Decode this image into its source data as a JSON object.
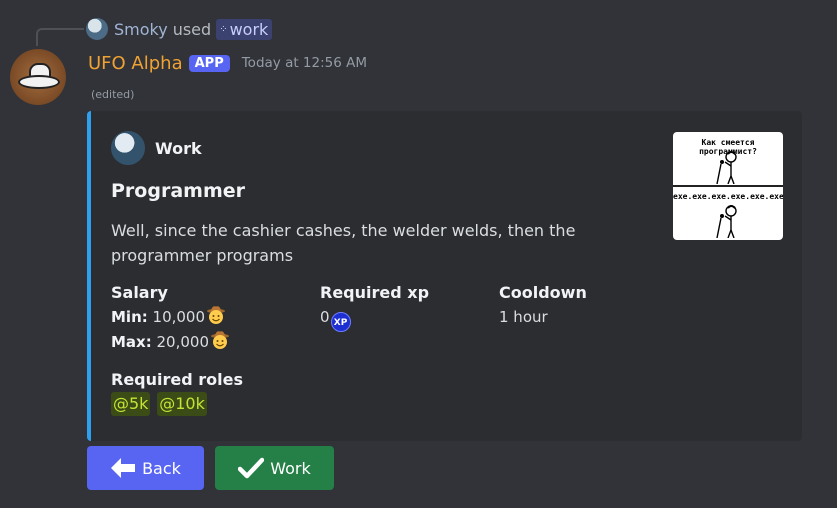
{
  "reply": {
    "user_name": "Smoky",
    "used_text": "used",
    "command_name": "work"
  },
  "message": {
    "author_name": "UFO Alpha",
    "badge": "APP",
    "timestamp": "Today at 12:56 AM",
    "edited": "(edited)"
  },
  "embed": {
    "accent_color": "#2da0f0",
    "author_name": "Work",
    "title": "Programmer",
    "description": "Well, since the cashier cashes, the welder welds, then the programmer programs",
    "thumbnail": {
      "top_text": "Как смеется программист?",
      "bottom_text": "exe.exe.exe.exe.exe.exe"
    },
    "salary": {
      "name": "Salary",
      "min_label": "Min:",
      "min_value": "10,000",
      "max_label": "Max:",
      "max_value": "20,000",
      "currency_icon": "cowboy-emoji-icon"
    },
    "required_xp": {
      "name": "Required xp",
      "value": "0",
      "icon_label": "XP"
    },
    "cooldown": {
      "name": "Cooldown",
      "value": "1 hour"
    },
    "required_roles": {
      "name": "Required roles",
      "roles": [
        "@5k",
        "@10k"
      ],
      "role_color": "#c5e335"
    }
  },
  "buttons": {
    "back": {
      "label": "Back",
      "icon": "arrow-left-icon",
      "color": "#5865f2"
    },
    "work": {
      "label": "Work",
      "icon": "checkmark-icon",
      "color": "#248046"
    }
  }
}
